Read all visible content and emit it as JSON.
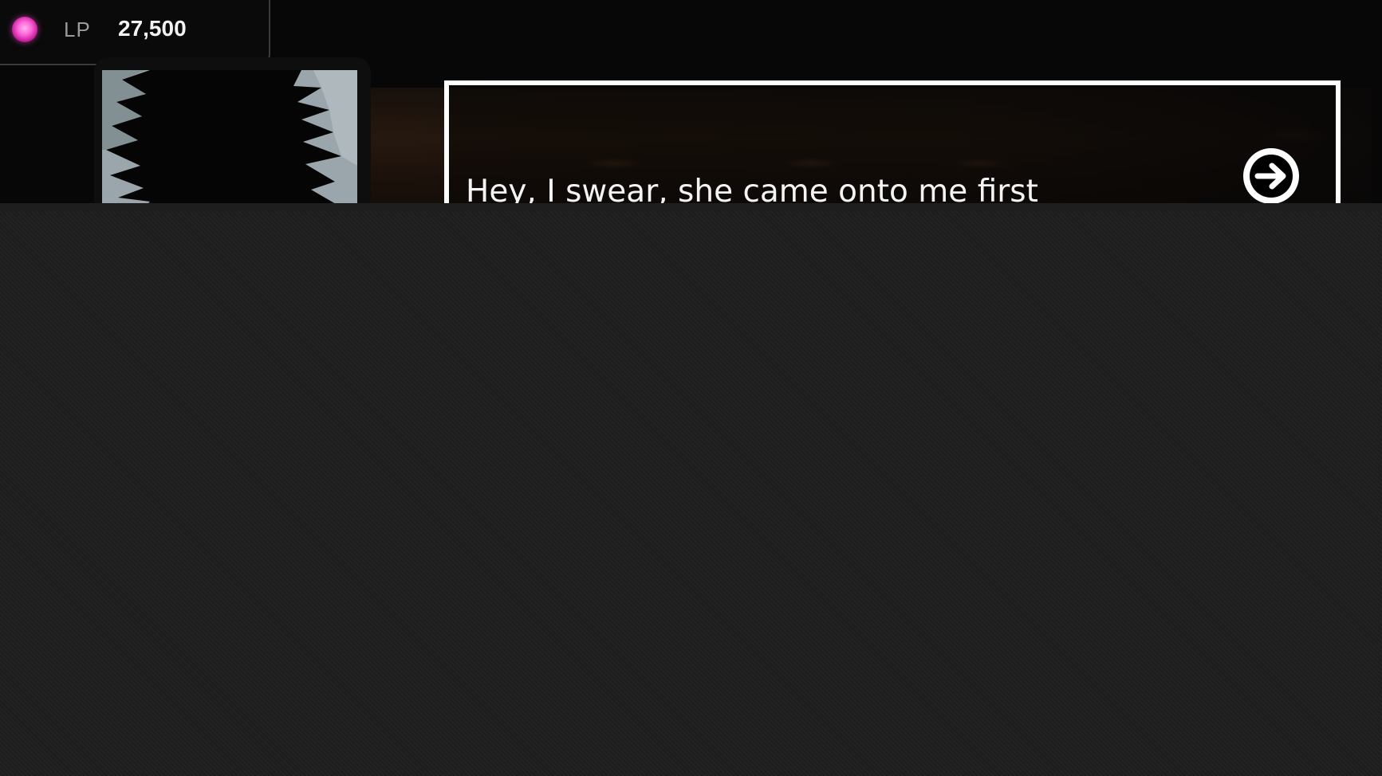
{
  "hud": {
    "lp_label": "LP",
    "lp_value": "27,500",
    "gem_icon": "pink-gem-icon",
    "gem_color": "#ff66d9"
  },
  "dialogue": {
    "text": "Hey, I swear, she came onto me first",
    "next_icon": "arrow-right-circle-icon"
  },
  "overlay": {
    "color": "#1e1e1e"
  }
}
